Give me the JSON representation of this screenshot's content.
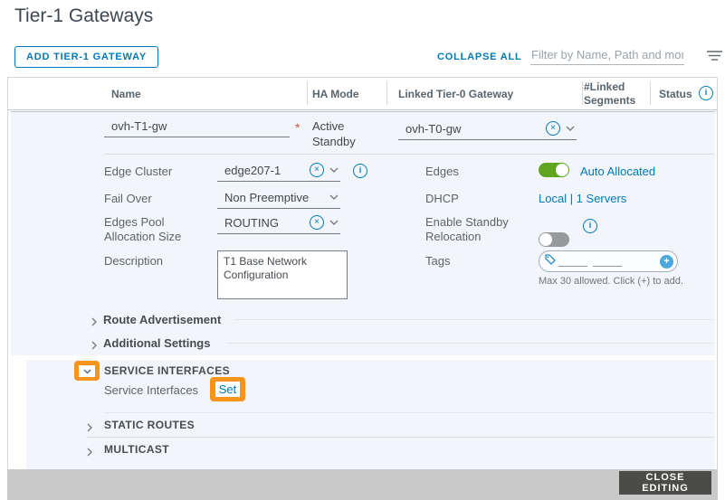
{
  "page": {
    "title": "Tier-1 Gateways"
  },
  "toolbar": {
    "add_button": "ADD TIER-1 GATEWAY",
    "collapse_all": "COLLAPSE ALL",
    "filter_placeholder": "Filter by Name, Path and more"
  },
  "table": {
    "headers": [
      "Name",
      "HA Mode",
      "Linked Tier-0 Gateway",
      "#Linked Segments",
      "Status"
    ]
  },
  "form": {
    "name_value": "ovh-T1-gw",
    "ha_mode": "Active Standby",
    "linked_tier0_value": "ovh-T0-gw",
    "edge_cluster_label": "Edge Cluster",
    "edge_cluster_value": "edge207-1",
    "fail_over_label": "Fail Over",
    "fail_over_value": "Non Preemptive",
    "pool_label": "Edges Pool Allocation Size",
    "pool_value": "ROUTING",
    "description_label": "Description",
    "description_value": "T1 Base Network Configuration",
    "edges_label": "Edges",
    "edges_value": "Auto Allocated",
    "dhcp_label": "DHCP",
    "dhcp_value": "Local | 1 Servers",
    "standby_label": "Enable Standby Relocation",
    "tags_label": "Tags",
    "tags_hint": "Max 30 allowed. Click (+) to add."
  },
  "sections": {
    "route_advertisement": "Route Advertisement",
    "additional_settings": "Additional Settings",
    "service_interfaces_title": "SERVICE INTERFACES",
    "service_interfaces_label": "Service Interfaces",
    "set_link": "Set",
    "static_routes": "STATIC ROUTES",
    "multicast": "MULTICAST"
  },
  "footer": {
    "close_editing": "CLOSE EDITING"
  },
  "icons": {
    "clear": "×",
    "info": "i",
    "add": "+",
    "required": "*"
  },
  "colors": {
    "accent_blue": "#0079b8",
    "toggle_green": "#62a420",
    "highlight_orange": "#f7941e",
    "panel_blue": "#f2f6fa",
    "footer_gray": "#c9c9c9",
    "close_button_gray": "#4b4b47"
  }
}
